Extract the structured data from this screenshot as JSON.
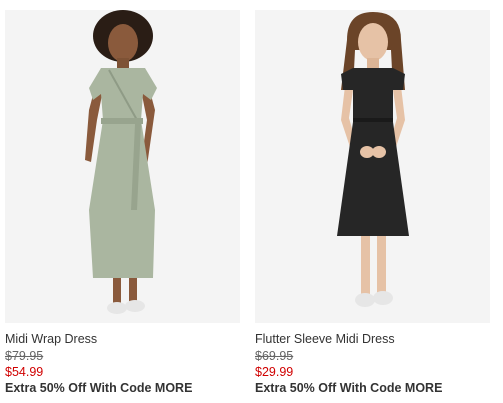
{
  "colors": {
    "sale_price": "#d00000",
    "text": "#333333",
    "image_background": "#f4f4f4",
    "dress_1": "#aab6a0",
    "dress_2": "#262626"
  },
  "products": [
    {
      "name": "Midi Wrap Dress",
      "original_price": "$79.95",
      "sale_price": "$54.99",
      "promo": "Extra 50% Off With Code MORE"
    },
    {
      "name": "Flutter Sleeve Midi Dress",
      "original_price": "$69.95",
      "sale_price": "$29.99",
      "promo": "Extra 50% Off With Code MORE"
    }
  ]
}
